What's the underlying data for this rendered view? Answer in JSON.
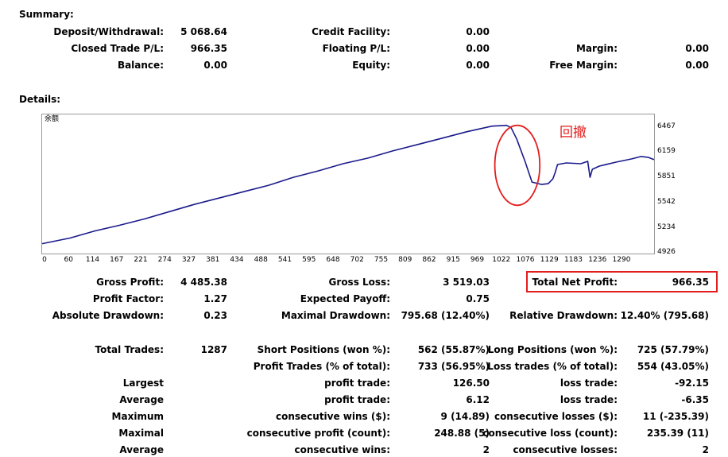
{
  "summary": {
    "title": "Summary:",
    "rows": [
      [
        {
          "label": "Deposit/Withdrawal:",
          "value": "5 068.64"
        },
        {
          "label": "Credit Facility:",
          "value": "0.00"
        },
        {
          "label": "",
          "value": ""
        }
      ],
      [
        {
          "label": "Closed Trade P/L:",
          "value": "966.35"
        },
        {
          "label": "Floating P/L:",
          "value": "0.00"
        },
        {
          "label": "Margin:",
          "value": "0.00"
        }
      ],
      [
        {
          "label": "Balance:",
          "value": "0.00"
        },
        {
          "label": "Equity:",
          "value": "0.00"
        },
        {
          "label": "Free Margin:",
          "value": "0.00"
        }
      ]
    ]
  },
  "details": {
    "title": "Details:",
    "legend": "余额",
    "annotation": "回撤",
    "rows": [
      [
        {
          "label": "Gross Profit:",
          "value": "4 485.38"
        },
        {
          "label": "Gross Loss:",
          "value": "3 519.03"
        },
        {
          "label": "Total Net Profit:",
          "value": "966.35"
        }
      ],
      [
        {
          "label": "Profit Factor:",
          "value": "1.27"
        },
        {
          "label": "Expected Payoff:",
          "value": "0.75"
        },
        {
          "label": "",
          "value": ""
        }
      ],
      [
        {
          "label": "Absolute Drawdown:",
          "value": "0.23"
        },
        {
          "label": "Maximal Drawdown:",
          "value": "795.68 (12.40%)"
        },
        {
          "label": "Relative Drawdown:",
          "value": "12.40% (795.68)"
        }
      ],
      [
        {
          "label": "Total Trades:",
          "value": "1287"
        },
        {
          "label": "Short Positions (won %):",
          "value": "562 (55.87%)"
        },
        {
          "label": "Long Positions (won %):",
          "value": "725 (57.79%)"
        }
      ],
      [
        {
          "label": "",
          "value": ""
        },
        {
          "label": "Profit Trades (% of total):",
          "value": "733 (56.95%)"
        },
        {
          "label": "Loss trades (% of total):",
          "value": "554 (43.05%)"
        }
      ],
      [
        {
          "label": "Largest",
          "value": ""
        },
        {
          "label": "profit trade:",
          "value": "126.50"
        },
        {
          "label": "loss trade:",
          "value": "-92.15"
        }
      ],
      [
        {
          "label": "Average",
          "value": ""
        },
        {
          "label": "profit trade:",
          "value": "6.12"
        },
        {
          "label": "loss trade:",
          "value": "-6.35"
        }
      ],
      [
        {
          "label": "Maximum",
          "value": ""
        },
        {
          "label": "consecutive wins ($):",
          "value": "9 (14.89)"
        },
        {
          "label": "consecutive losses ($):",
          "value": "11 (-235.39)"
        }
      ],
      [
        {
          "label": "Maximal",
          "value": ""
        },
        {
          "label": "consecutive profit (count):",
          "value": "248.88 (5)"
        },
        {
          "label": "consecutive loss (count):",
          "value": "235.39 (11)"
        }
      ],
      [
        {
          "label": "Average",
          "value": ""
        },
        {
          "label": "consecutive wins:",
          "value": "2"
        },
        {
          "label": "consecutive losses:",
          "value": "2"
        }
      ]
    ]
  },
  "chart_data": {
    "type": "line",
    "xticks": [
      "0",
      "60",
      "114",
      "167",
      "221",
      "274",
      "327",
      "381",
      "434",
      "488",
      "541",
      "595",
      "648",
      "702",
      "755",
      "809",
      "862",
      "915",
      "969",
      "1022",
      "1076",
      "1129",
      "1183",
      "1236",
      "1290"
    ],
    "yticks": [
      "6467",
      "6159",
      "5851",
      "5542",
      "5234",
      "4926"
    ],
    "xlim": [
      0,
      1318
    ],
    "ylim": [
      4926,
      6467
    ],
    "line_color": "#1a1a8c",
    "highlight_color": "#e31d1d",
    "series": [
      {
        "x": [
          0,
          60,
          114,
          167,
          221,
          274,
          327,
          381,
          434,
          488,
          541,
          595,
          648,
          702,
          755,
          809,
          862,
          915,
          969,
          1000,
          1010,
          1022,
          1040,
          1055,
          1076,
          1090,
          1100,
          1105,
          1110,
          1129,
          1160,
          1175,
          1180,
          1185,
          1200,
          1236,
          1270,
          1290,
          1305,
          1318
        ],
        "y": [
          4990,
          5060,
          5150,
          5220,
          5300,
          5390,
          5480,
          5560,
          5640,
          5720,
          5820,
          5900,
          5990,
          6060,
          6150,
          6230,
          6310,
          6390,
          6460,
          6470,
          6440,
          6300,
          6020,
          5760,
          5730,
          5740,
          5800,
          5880,
          5980,
          6000,
          5990,
          6020,
          5820,
          5920,
          5960,
          6010,
          6050,
          6080,
          6070,
          6040
        ]
      }
    ]
  }
}
